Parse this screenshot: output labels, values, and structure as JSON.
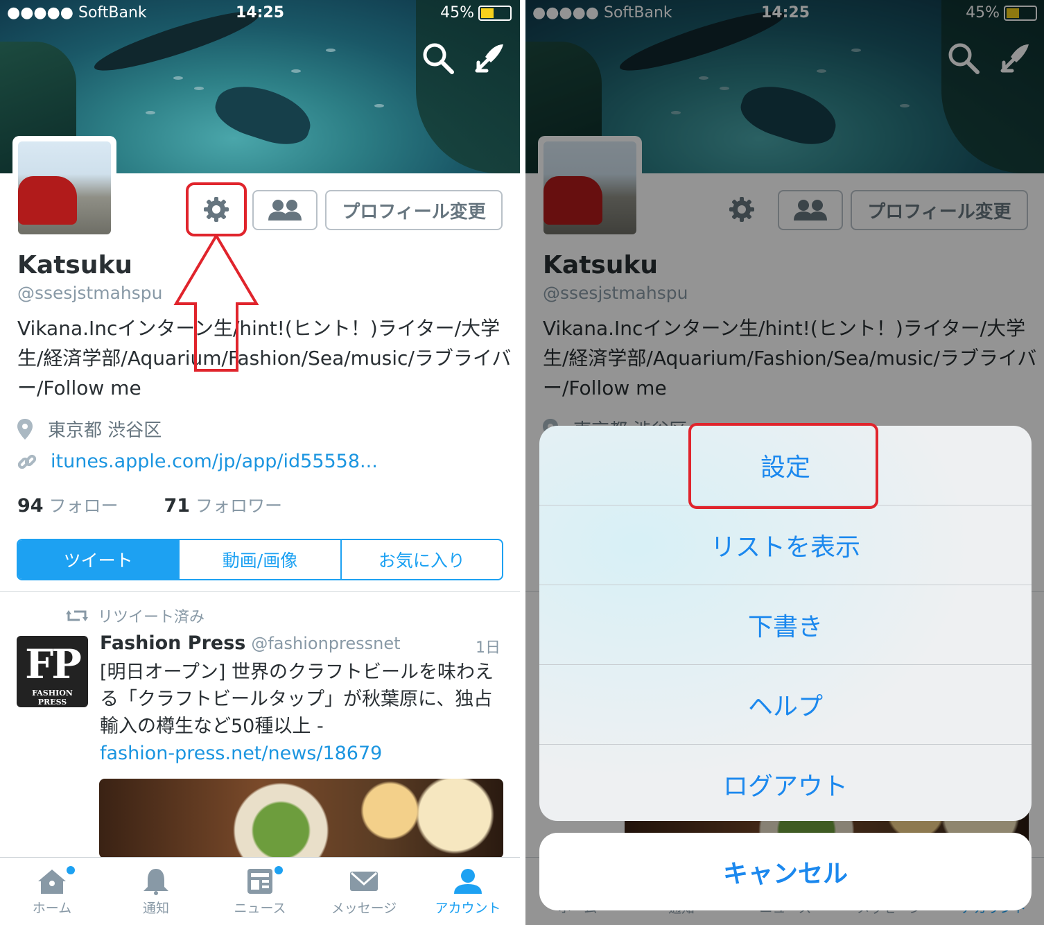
{
  "status_bar": {
    "carrier": "●●●●● SoftBank",
    "time": "14:25",
    "battery": "45%",
    "battery_level": 0.45
  },
  "profile": {
    "edit_label": "プロフィール変更",
    "name": "Katsuku",
    "handle": "@ssesjstmahspu",
    "bio": "Vikana.Incインターン生/hint!(ヒント！)ライター/大学生/経済学部/Aquarium/Fashion/Sea/music/ラブライバー/Follow me",
    "location": "東京都 渋谷区",
    "url": "itunes.apple.com/jp/app/id55558...",
    "following_count": "94",
    "following_label": "フォロー",
    "followers_count": "71",
    "followers_label": "フォロワー"
  },
  "tabs": [
    {
      "label": "ツイート"
    },
    {
      "label": "動画/画像"
    },
    {
      "label": "お気に入り"
    }
  ],
  "tweet": {
    "retweet_label": "リツイート済み",
    "avatar_big": "FP",
    "avatar_small": "FASHION PRESS",
    "author": "Fashion Press",
    "author_handle": "@fashionpressnet",
    "time": "1日",
    "text": "[明日オープン] 世界のクラフトビールを味わえる「クラフトビールタップ」が秋葉原に、独占輸入の樽生など50種以上 -",
    "link": "fashion-press.net/news/18679"
  },
  "tab_bar": [
    {
      "label": "ホーム",
      "icon": "home-icon"
    },
    {
      "label": "通知",
      "icon": "bell-icon"
    },
    {
      "label": "ニュース",
      "icon": "news-icon"
    },
    {
      "label": "メッセージ",
      "icon": "envelope-icon"
    },
    {
      "label": "アカウント",
      "icon": "person-icon"
    }
  ],
  "action_sheet": {
    "items": [
      {
        "label": "設定"
      },
      {
        "label": "リストを表示"
      },
      {
        "label": "下書き"
      },
      {
        "label": "ヘルプ"
      },
      {
        "label": "ログアウト"
      }
    ],
    "cancel_label": "キャンセル"
  },
  "colors": {
    "accent": "#1da1f2",
    "highlight": "#e0242c",
    "link": "#1b95e0",
    "sheet_text": "#1b88ee"
  }
}
